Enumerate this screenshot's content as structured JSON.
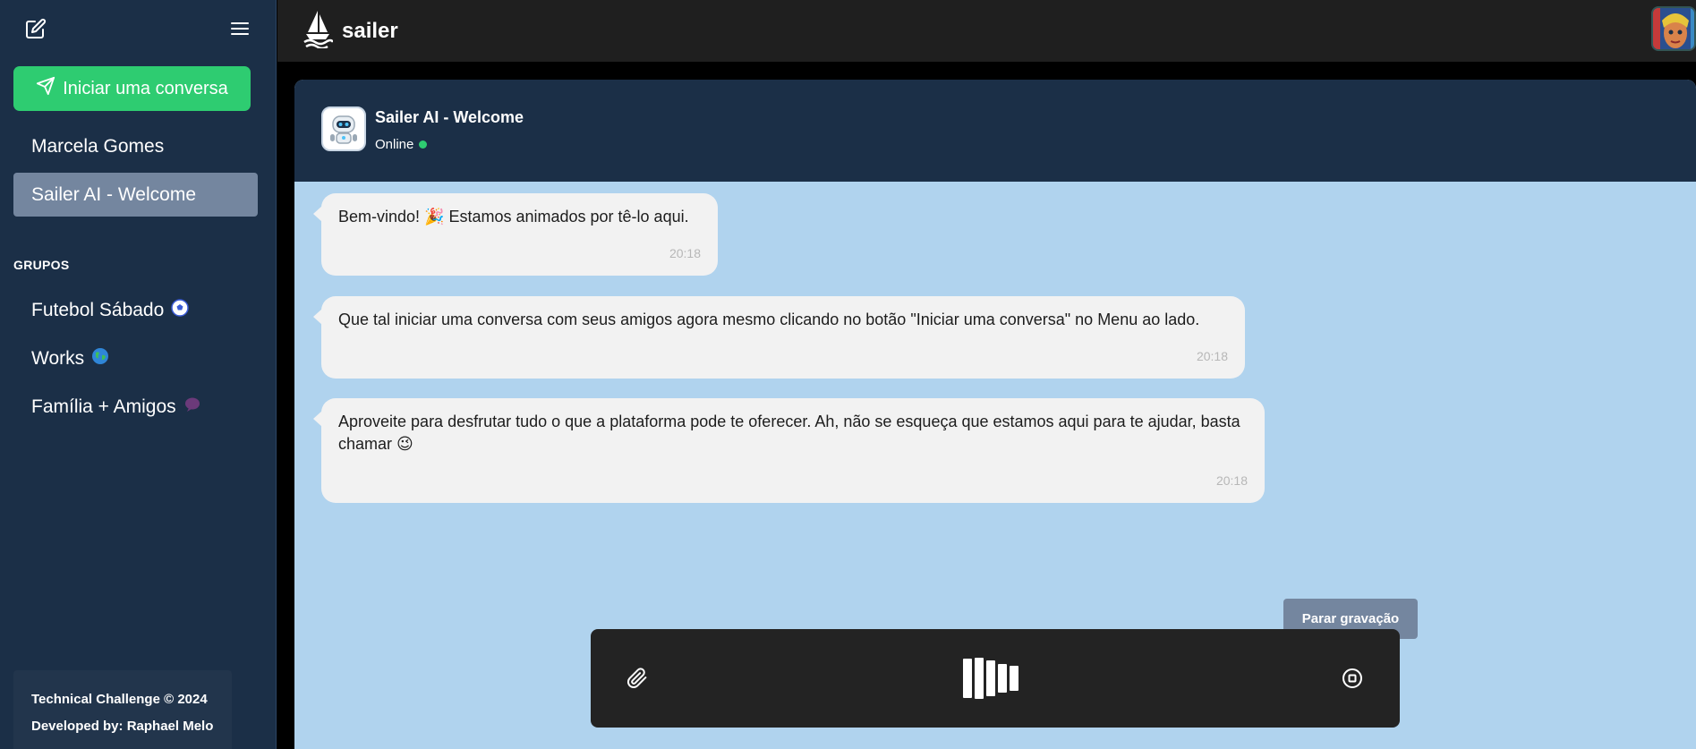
{
  "sidebar": {
    "new_chat_label": "Iniciar uma conversa",
    "contacts": [
      {
        "label": "Marcela Gomes"
      },
      {
        "label": "Sailer AI - Welcome"
      }
    ],
    "groups_heading": "GRUPOS",
    "groups": [
      {
        "label": "Futebol Sábado",
        "icon": "soccer-ball-icon"
      },
      {
        "label": "Works",
        "icon": "globe-icon"
      },
      {
        "label": "Família + Amigos",
        "icon": "speech-bubble-icon"
      }
    ],
    "footer": {
      "line1": "Technical Challenge © 2024",
      "line2": "Developed by: Raphael Melo"
    }
  },
  "topbar": {
    "brand": "sailer"
  },
  "chat": {
    "title": "Sailer AI - Welcome",
    "status": "Online",
    "messages": [
      {
        "text": "Bem-vindo! 🎉 Estamos animados por tê-lo aqui.",
        "time": "20:18"
      },
      {
        "text": "Que tal iniciar uma conversa com seus amigos agora mesmo clicando no botão \"Iniciar uma conversa\" no Menu ao lado.",
        "time": "20:18"
      },
      {
        "text": "Aproveite para desfrutar tudo o que a plataforma pode te oferecer. Ah, não se esqueça que estamos aqui para te ajudar, basta chamar 😉",
        "time": "20:18"
      }
    ]
  },
  "composer": {
    "tooltip": "Parar gravação"
  },
  "colors": {
    "accent": "#2ecc71",
    "sidebar_bg": "#1b2f47",
    "chat_bg": "#b0d3ee",
    "active_item": "#74869f"
  }
}
